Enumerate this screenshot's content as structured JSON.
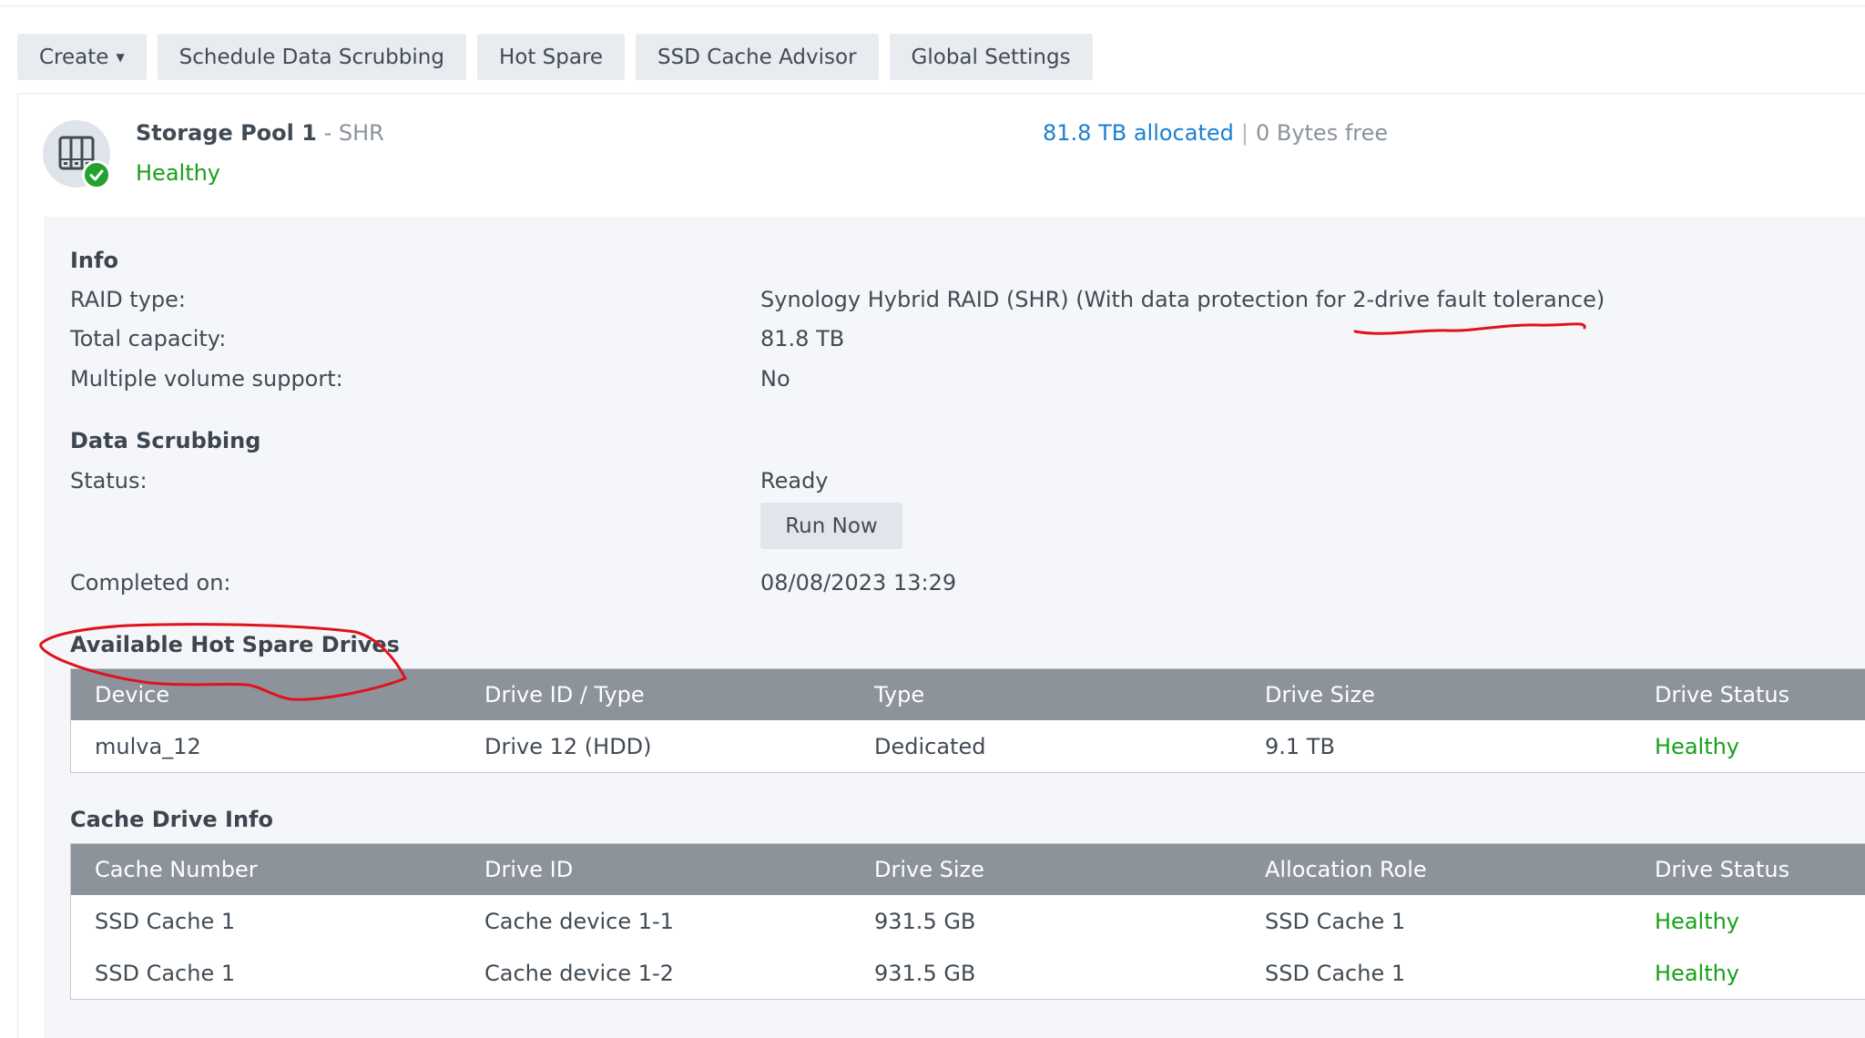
{
  "toolbar": {
    "create": "Create",
    "schedule": "Schedule Data Scrubbing",
    "hot_spare": "Hot Spare",
    "ssd_advisor": "SSD Cache Advisor",
    "global_settings": "Global Settings"
  },
  "pool": {
    "name": "Storage Pool 1",
    "type": "- SHR",
    "status": "Healthy",
    "allocated": "81.8 TB allocated",
    "separator": "|",
    "free": "0 Bytes free"
  },
  "info": {
    "heading": "Info",
    "raid_label": "RAID type:",
    "raid_value": "Synology Hybrid RAID (SHR) (With data protection for 2-drive fault tolerance)",
    "capacity_label": "Total capacity:",
    "capacity_value": "81.8 TB",
    "multi_label": "Multiple volume support:",
    "multi_value": "No"
  },
  "scrubbing": {
    "heading": "Data Scrubbing",
    "status_label": "Status:",
    "status_value": "Ready",
    "run_now": "Run Now",
    "completed_label": "Completed on:",
    "completed_value": "08/08/2023 13:29"
  },
  "hot_spare": {
    "heading": "Available Hot Spare Drives",
    "columns": [
      "Device",
      "Drive ID / Type",
      "Type",
      "Drive Size",
      "Drive Status"
    ],
    "rows": [
      [
        "mulva_12",
        "Drive 12 (HDD)",
        "Dedicated",
        "9.1 TB",
        "Healthy"
      ]
    ]
  },
  "cache": {
    "heading": "Cache Drive Info",
    "columns": [
      "Cache Number",
      "Drive ID",
      "Drive Size",
      "Allocation Role",
      "Drive Status"
    ],
    "rows": [
      [
        "SSD Cache 1",
        "Cache device 1-1",
        "931.5 GB",
        "SSD Cache 1",
        "Healthy"
      ],
      [
        "SSD Cache 1",
        "Cache device 1-2",
        "931.5 GB",
        "SSD Cache 1",
        "Healthy"
      ]
    ]
  },
  "colors": {
    "healthy": "#18a018",
    "link": "#1b7fd4",
    "header_bg": "#8c939b",
    "annotation": "#e0121c"
  },
  "icons": {
    "pool": "storage-pool-icon",
    "status": "check-circle-icon",
    "caret": "caret-down-icon"
  }
}
